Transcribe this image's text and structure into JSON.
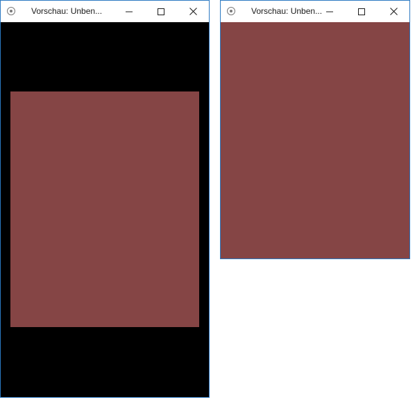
{
  "windows": [
    {
      "title": "Vorschau: Unben...",
      "client_background": "#000000",
      "content_color": "#854545"
    },
    {
      "title": "Vorschau: Unben...",
      "client_background": "#854545",
      "content_color": "#854545"
    }
  ],
  "icons": {
    "app": "preview-app-icon",
    "minimize": "minimize-icon",
    "maximize": "maximize-icon",
    "close": "close-icon"
  },
  "colors": {
    "window_border": "#2b79c2",
    "titlebar": "#ffffff",
    "preview_fill": "#854545",
    "letterbox": "#000000"
  }
}
